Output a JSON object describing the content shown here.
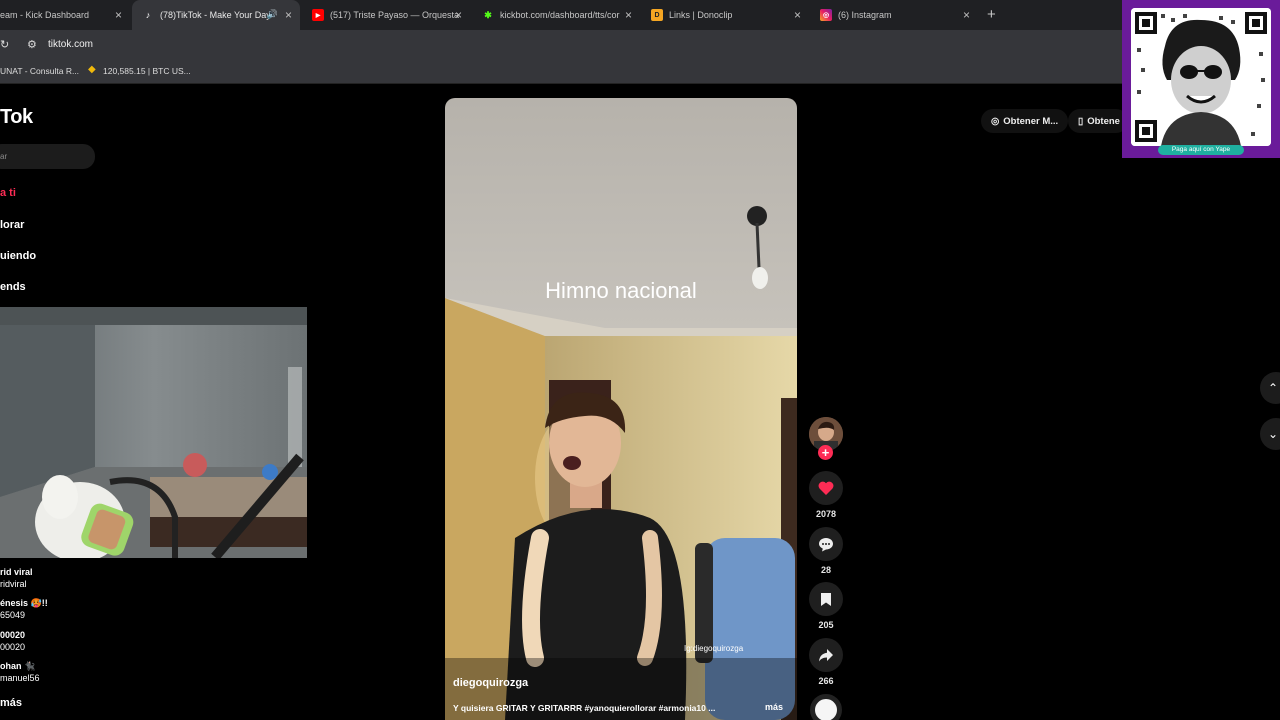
{
  "browser": {
    "tabs": [
      {
        "title": "eam - Kick Dashboard",
        "favicon": "kick-icon",
        "active": false
      },
      {
        "title": "(78)TikTok - Make Your Day",
        "favicon": "tiktok-icon",
        "active": true,
        "muted_icon": "speaker-icon"
      },
      {
        "title": "(517) Triste Payaso — Orquesta",
        "favicon": "youtube-icon",
        "active": false
      },
      {
        "title": "kickbot.com/dashboard/tts/cor",
        "favicon": "kickbot-icon",
        "active": false
      },
      {
        "title": "Links | Donoclip",
        "favicon": "donoclip-icon",
        "active": false
      },
      {
        "title": "(6) Instagram",
        "favicon": "instagram-icon",
        "active": false
      }
    ],
    "url": "tiktok.com",
    "bookmarks": [
      {
        "label": "UNAT - Consulta R..."
      },
      {
        "label": "120,585.15 | BTC US..."
      }
    ]
  },
  "sidebar": {
    "logo": "Tok",
    "search_placeholder": "ar",
    "nav": [
      {
        "label": "a ti",
        "active": true
      },
      {
        "label": "lorar",
        "active": false
      },
      {
        "label": "uiendo",
        "active": false
      },
      {
        "label": "ends",
        "active": false
      }
    ],
    "live": [
      {
        "title": "rid viral",
        "sub": "ridviral"
      },
      {
        "title": "énesis 🥵!!",
        "sub": "65049"
      },
      {
        "title": "00020",
        "sub": "00020"
      },
      {
        "title": "ohan 🐈‍⬛",
        "sub": "manuel56"
      }
    ],
    "more_label": "más"
  },
  "video": {
    "caption": "Himno nacional",
    "watermark": "Ig:diegoquirozga",
    "author": "diegoquirozga",
    "description": "Y quisiera GRITAR Y GRITARRR #yanoquierollorar #armonia10 ...",
    "more": "más"
  },
  "actions": {
    "likes": "2078",
    "comments": "28",
    "saves": "205",
    "shares": "266",
    "follow_symbol": "+"
  },
  "top_right": {
    "get_app": "Obtener M...",
    "get_app2": "Obtene"
  },
  "overlay": {
    "qr_caption": "Paga aquí con Yape"
  },
  "colors": {
    "accent": "#fe2c55",
    "qr_frame": "#6a1b9a",
    "yape": "#1fb0a0"
  }
}
